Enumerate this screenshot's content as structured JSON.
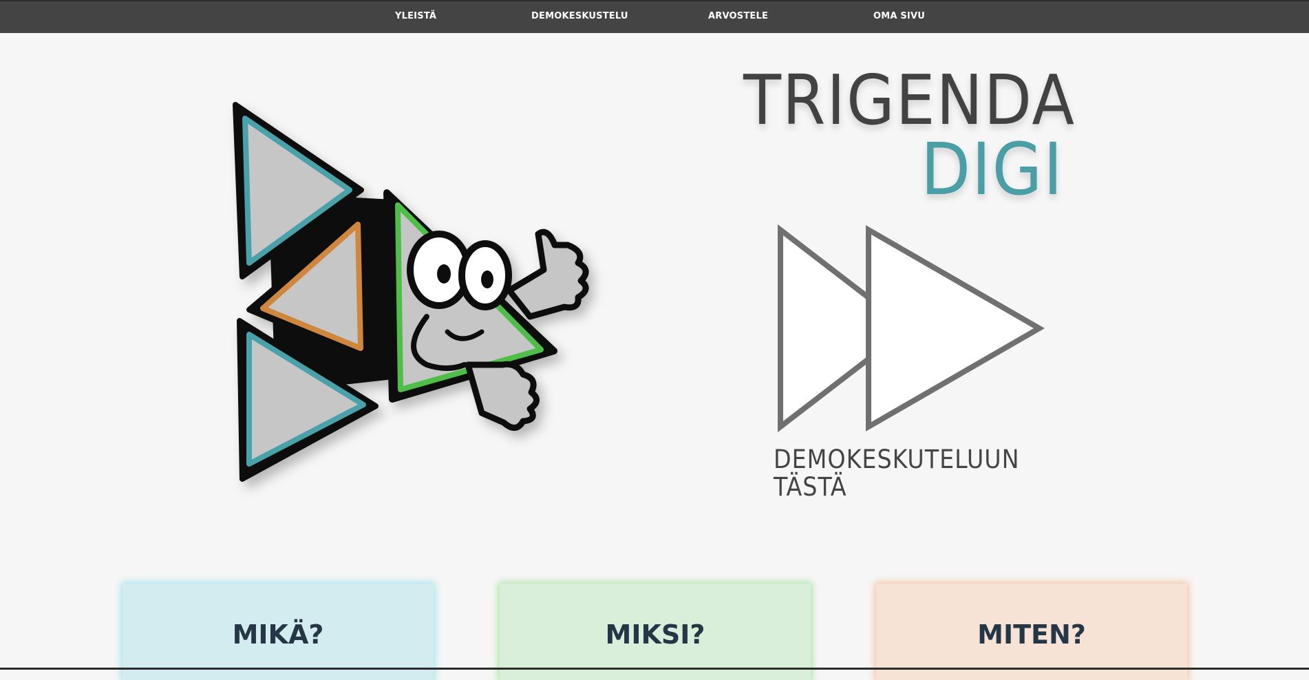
{
  "nav": {
    "items": [
      {
        "label": "YLEISTÄ"
      },
      {
        "label": "DEMOKESKUSTELU"
      },
      {
        "label": "ARVOSTELE"
      },
      {
        "label": "OMA SIVU"
      }
    ]
  },
  "brand": {
    "line1": "TRIGENDA",
    "line2": "DIGI"
  },
  "cta": {
    "line1": "DEMOKESKUTELUUN",
    "line2": "TÄSTÄ"
  },
  "cards": [
    {
      "title": "MIKÄ?"
    },
    {
      "title": "MIKSI?"
    },
    {
      "title": "MITEN?"
    }
  ],
  "colors": {
    "topbar": "#444444",
    "brand_dark": "#424242",
    "brand_teal": "#4a9fa6",
    "card_blue": "#d3ecef",
    "card_green": "#d9efd9",
    "card_orange": "#f7e3d6",
    "card_text": "#253646"
  },
  "icons": {
    "mascot": "triangle-fish-mascot-icon",
    "cta": "fast-forward-icon"
  }
}
